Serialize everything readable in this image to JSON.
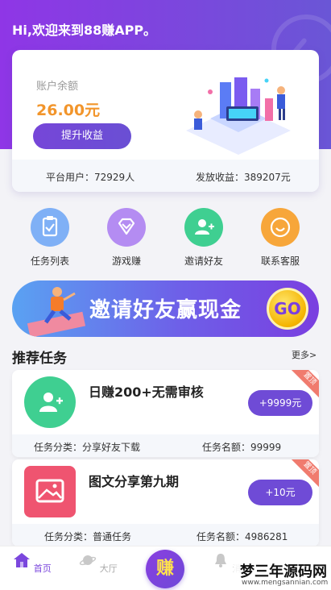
{
  "header": {
    "greeting": "Hi,欢迎来到88赚APP。"
  },
  "account": {
    "balance_label": "账户余额",
    "balance_value": "26.00元",
    "boost_button": "提升收益",
    "platform_users": "平台用户：72929人",
    "payout_total": "发放收益：389207元"
  },
  "quick_actions": [
    {
      "label": "任务列表",
      "icon": "clipboard-check-icon",
      "color": "#7fb0f6"
    },
    {
      "label": "游戏赚",
      "icon": "diamond-icon",
      "color": "#b48cf2"
    },
    {
      "label": "邀请好友",
      "icon": "add-user-icon",
      "color": "#3fcf91"
    },
    {
      "label": "联系客服",
      "icon": "smiley-icon",
      "color": "#f7a63a"
    }
  ],
  "banner": {
    "text": "邀请好友赢现金",
    "go": "GO"
  },
  "recommend": {
    "title": "推荐任务",
    "more": "更多>"
  },
  "tasks": [
    {
      "title": "日赚200+无需审核",
      "button": "+9999元",
      "ribbon": "置顶",
      "category": "任务分类：分享好友下载",
      "quota": "任务名额：99999",
      "icon": "add-user-icon",
      "icon_color": "#3fcf91"
    },
    {
      "title": "图文分享第九期",
      "button": "+10元",
      "ribbon": "置顶",
      "category": "任务分类：普通任务",
      "quota": "任务名额：4986281",
      "icon": "image-icon",
      "icon_color": "#ef5470"
    }
  ],
  "tabbar": {
    "home": "首页",
    "hall": "大厅",
    "earn": "赚",
    "messages": "消息"
  },
  "watermark": {
    "title": "梦三年源码网",
    "url": "www.mengsannian.com"
  },
  "colors": {
    "brand": "#7b47dd",
    "accent": "#f2952b"
  }
}
